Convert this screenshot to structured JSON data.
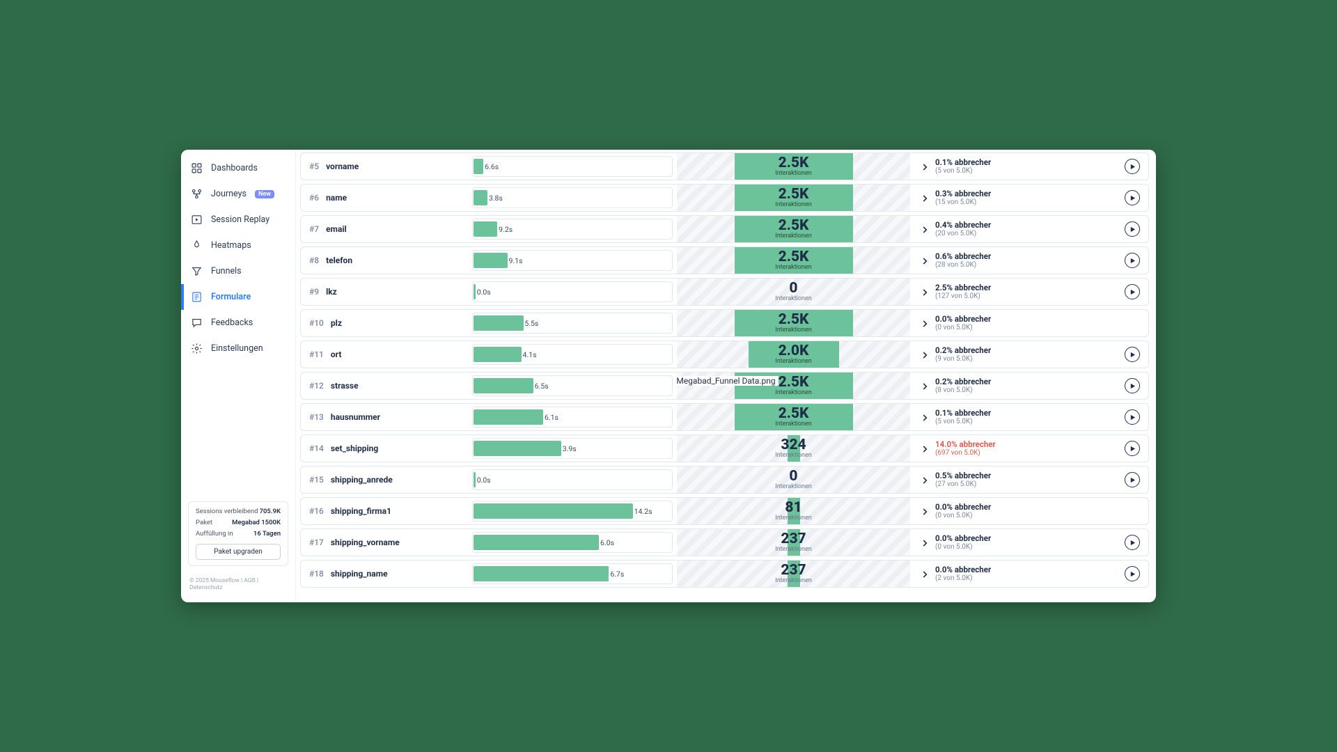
{
  "sidebar": {
    "items": [
      {
        "label": "Dashboards",
        "icon": "dashboard"
      },
      {
        "label": "Journeys",
        "icon": "journey",
        "badge": "New"
      },
      {
        "label": "Session Replay",
        "icon": "replay"
      },
      {
        "label": "Heatmaps",
        "icon": "heatmap"
      },
      {
        "label": "Funnels",
        "icon": "funnel"
      },
      {
        "label": "Formulare",
        "icon": "form"
      },
      {
        "label": "Feedbacks",
        "icon": "feedback"
      },
      {
        "label": "Einstellungen",
        "icon": "settings"
      }
    ],
    "active": 5
  },
  "usage": {
    "label_sessions": "Sessions verbleibend",
    "sessions": "705.9K",
    "label_paket": "Paket",
    "paket": "Megabad 1500K",
    "label_refill": "Auffüllung in",
    "refill": "16 Tagen",
    "upgrade": "Paket upgraden"
  },
  "footer": "© 2025 Mouseflow  | AGB | Datenschutz",
  "interaktionen_label": "Interaktionen",
  "abbrecher_word": "abbrecher",
  "von_word": "von",
  "total": "5.0K",
  "file_caption": "Megabad_Funnel Data.png",
  "rows": [
    {
      "idx": "#5",
      "name": "vorname",
      "time": "6.6s",
      "timePct": 5,
      "count": "2.5K",
      "badge": "green",
      "abbr_pct": "0.1%",
      "abbr_detail": "(5 von 5.0K)",
      "play": true
    },
    {
      "idx": "#6",
      "name": "name",
      "time": "3.8s",
      "timePct": 7,
      "count": "2.5K",
      "badge": "green",
      "abbr_pct": "0.3%",
      "abbr_detail": "(15 von 5.0K)",
      "play": true
    },
    {
      "idx": "#7",
      "name": "email",
      "time": "9.2s",
      "timePct": 12,
      "count": "2.5K",
      "badge": "green",
      "abbr_pct": "0.4%",
      "abbr_detail": "(20 von 5.0K)",
      "play": true
    },
    {
      "idx": "#8",
      "name": "telefon",
      "time": "9.1s",
      "timePct": 17,
      "count": "2.5K",
      "badge": "green",
      "abbr_pct": "0.6%",
      "abbr_detail": "(28 von 5.0K)",
      "play": true
    },
    {
      "idx": "#9",
      "name": "lkz",
      "time": "0.0s",
      "timePct": 0,
      "count": "0",
      "badge": "none",
      "abbr_pct": "2.5%",
      "abbr_detail": "(127 von 5.0K)",
      "play": true
    },
    {
      "idx": "#10",
      "name": "plz",
      "time": "5.5s",
      "timePct": 25,
      "count": "2.5K",
      "badge": "green",
      "abbr_pct": "0.0%",
      "abbr_detail": "(0 von 5.0K)",
      "play": false
    },
    {
      "idx": "#11",
      "name": "ort",
      "time": "4.1s",
      "timePct": 24,
      "count": "2.0K",
      "badge": "green",
      "badgeWidth": 130,
      "abbr_pct": "0.2%",
      "abbr_detail": "(9 von 5.0K)",
      "play": true
    },
    {
      "idx": "#12",
      "name": "strasse",
      "time": "6.5s",
      "timePct": 30,
      "count": "2.5K",
      "badge": "green",
      "abbr_pct": "0.2%",
      "abbr_detail": "(8 von 5.0K)",
      "play": true
    },
    {
      "idx": "#13",
      "name": "hausnummer",
      "time": "6.1s",
      "timePct": 35,
      "count": "2.5K",
      "badge": "green",
      "abbr_pct": "0.1%",
      "abbr_detail": "(5 von 5.0K)",
      "play": true
    },
    {
      "idx": "#14",
      "name": "set_shipping",
      "time": "3.9s",
      "timePct": 44,
      "count": "324",
      "badge": "narrow",
      "abbr_pct": "14.0%",
      "abbr_detail": "(697 von 5.0K)",
      "play": true,
      "warn": true
    },
    {
      "idx": "#15",
      "name": "shipping_anrede",
      "time": "0.0s",
      "timePct": 0,
      "count": "0",
      "badge": "none",
      "abbr_pct": "0.5%",
      "abbr_detail": "(27 von 5.0K)",
      "play": true
    },
    {
      "idx": "#16",
      "name": "shipping_firma1",
      "time": "14.2s",
      "timePct": 80,
      "count": "81",
      "badge": "narrow",
      "abbr_pct": "0.0%",
      "abbr_detail": "(0 von 5.0K)",
      "play": false
    },
    {
      "idx": "#17",
      "name": "shipping_vorname",
      "time": "6.0s",
      "timePct": 63,
      "count": "237",
      "badge": "narrow",
      "abbr_pct": "0.0%",
      "abbr_detail": "(0 von 5.0K)",
      "play": true
    },
    {
      "idx": "#18",
      "name": "shipping_name",
      "time": "6.7s",
      "timePct": 68,
      "count": "237",
      "badge": "narrow",
      "abbr_pct": "0.0%",
      "abbr_detail": "(2 von 5.0K)",
      "play": true
    }
  ]
}
